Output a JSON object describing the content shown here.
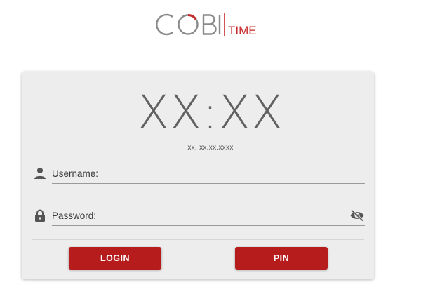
{
  "logo": {
    "text": "COBI",
    "suffix": "TIME",
    "accent_color": "#c62828",
    "text_color": "#8a8a8a"
  },
  "clock": {
    "time": "XX:XX",
    "date": "xx, xx.xx.xxxx"
  },
  "form": {
    "username": {
      "placeholder": "Username:",
      "value": "",
      "icon": "person-icon"
    },
    "password": {
      "placeholder": "Password:",
      "value": "",
      "icon": "lock-icon",
      "toggle_icon": "eye-off-icon"
    }
  },
  "buttons": {
    "login": "LOGIN",
    "pin": "PIN",
    "color": "#b71c1c"
  }
}
